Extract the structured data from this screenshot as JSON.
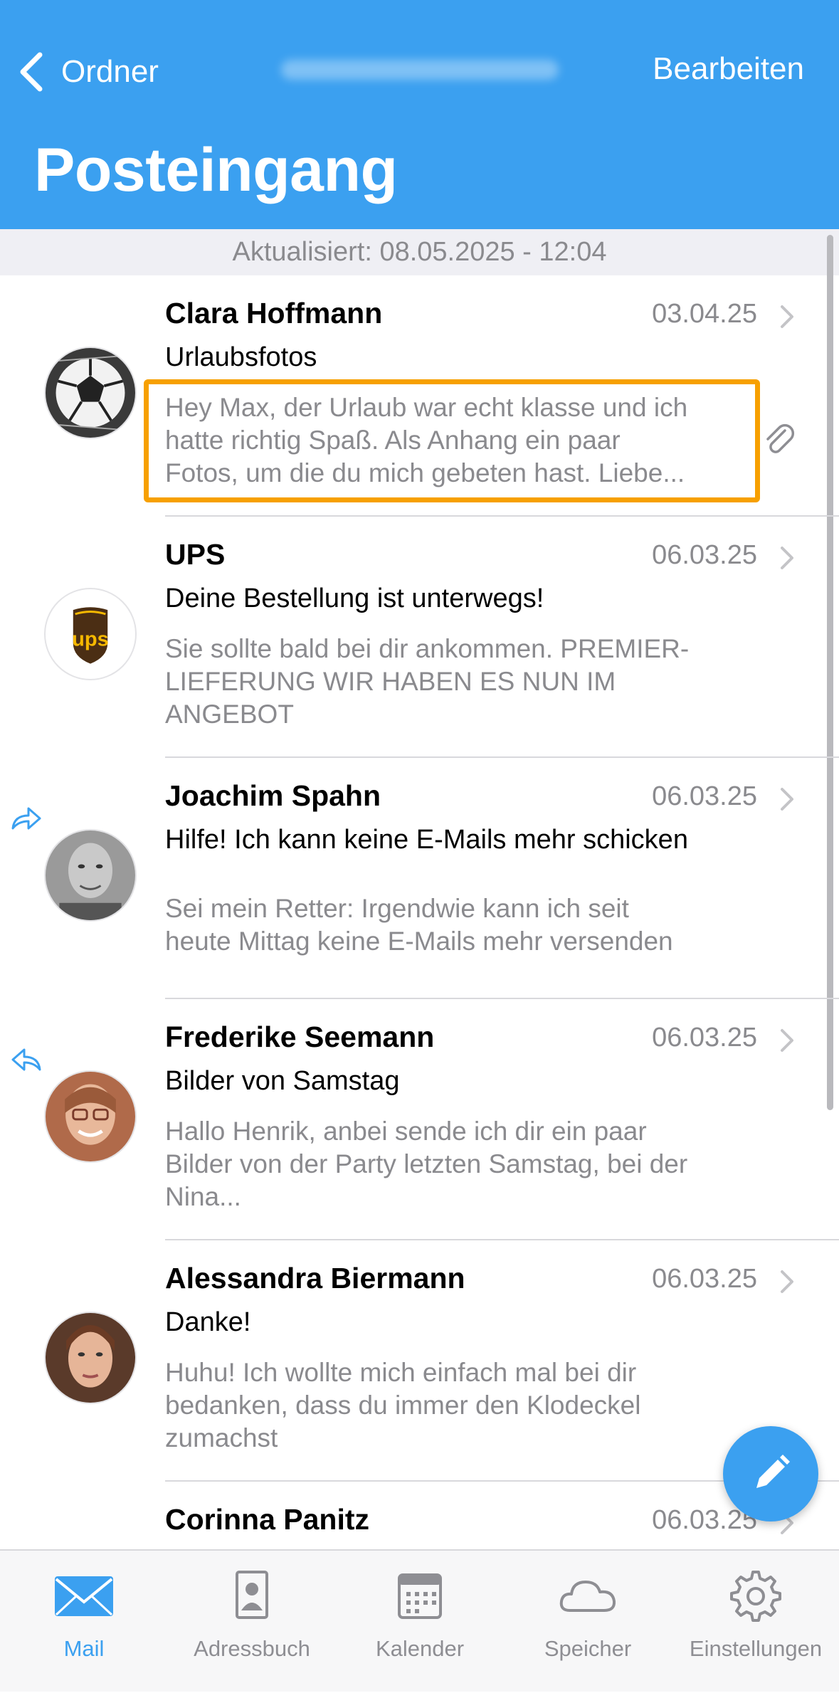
{
  "header": {
    "back_label": "Ordner",
    "edit_label": "Bearbeiten",
    "title": "Posteingang"
  },
  "update_status": "Aktualisiert: 08.05.2025 - 12:04",
  "messages": [
    {
      "sender": "Clara Hoffmann",
      "date": "03.04.25",
      "subject": "Urlaubsfotos",
      "preview": [
        "Hey Max, der Urlaub war echt klasse und ich",
        "hatte richtig Spaß. Als Anhang ein paar",
        "Fotos, um die du mich gebeten hast. Liebe..."
      ],
      "avatar": "soccer-ball-avatar",
      "attachment": true
    },
    {
      "sender": "UPS",
      "date": "06.03.25",
      "subject": "Deine Bestellung ist unterwegs!",
      "preview": [
        "Sie sollte bald bei dir ankommen. PREMIER-",
        "LIEFERUNG WIR HABEN ES NUN IM",
        "ANGEBOT"
      ],
      "avatar": "ups-logo-avatar",
      "logo_text": "ups"
    },
    {
      "sender": "Joachim Spahn",
      "date": "06.03.25",
      "subject": "Hilfe! Ich kann keine E-Mails mehr schicken",
      "preview": [
        "Sei mein Retter: Irgendwie kann ich seit",
        "heute Mittag keine E-Mails mehr versenden"
      ],
      "avatar": "man-portrait-avatar",
      "status": "forwarded-icon"
    },
    {
      "sender": "Frederike Seemann",
      "date": "06.03.25",
      "subject": "Bilder von Samstag",
      "preview": [
        "Hallo Henrik, anbei sende ich dir ein paar",
        "Bilder von der Party letzten Samstag, bei der",
        "Nina..."
      ],
      "avatar": "woman-glasses-avatar",
      "status": "replied-icon"
    },
    {
      "sender": "Alessandra Biermann",
      "date": "06.03.25",
      "subject": "Danke!",
      "preview": [
        "Huhu! Ich wollte mich einfach mal bei dir",
        "bedanken, dass du immer den Klodeckel",
        "zumachst"
      ],
      "avatar": "woman-portrait-avatar"
    },
    {
      "sender": "Corinna Panitz",
      "date": "06.03.25"
    }
  ],
  "tabs": [
    {
      "label": "Mail",
      "icon": "mail-icon",
      "active": true
    },
    {
      "label": "Adressbuch",
      "icon": "contact-book-icon"
    },
    {
      "label": "Kalender",
      "icon": "calendar-icon"
    },
    {
      "label": "Speicher",
      "icon": "cloud-icon"
    },
    {
      "label": "Einstellungen",
      "icon": "gear-icon"
    }
  ],
  "colors": {
    "accent": "#3ba0f0",
    "highlight_border": "#f7a000",
    "secondary_text": "#8a8a8e"
  }
}
